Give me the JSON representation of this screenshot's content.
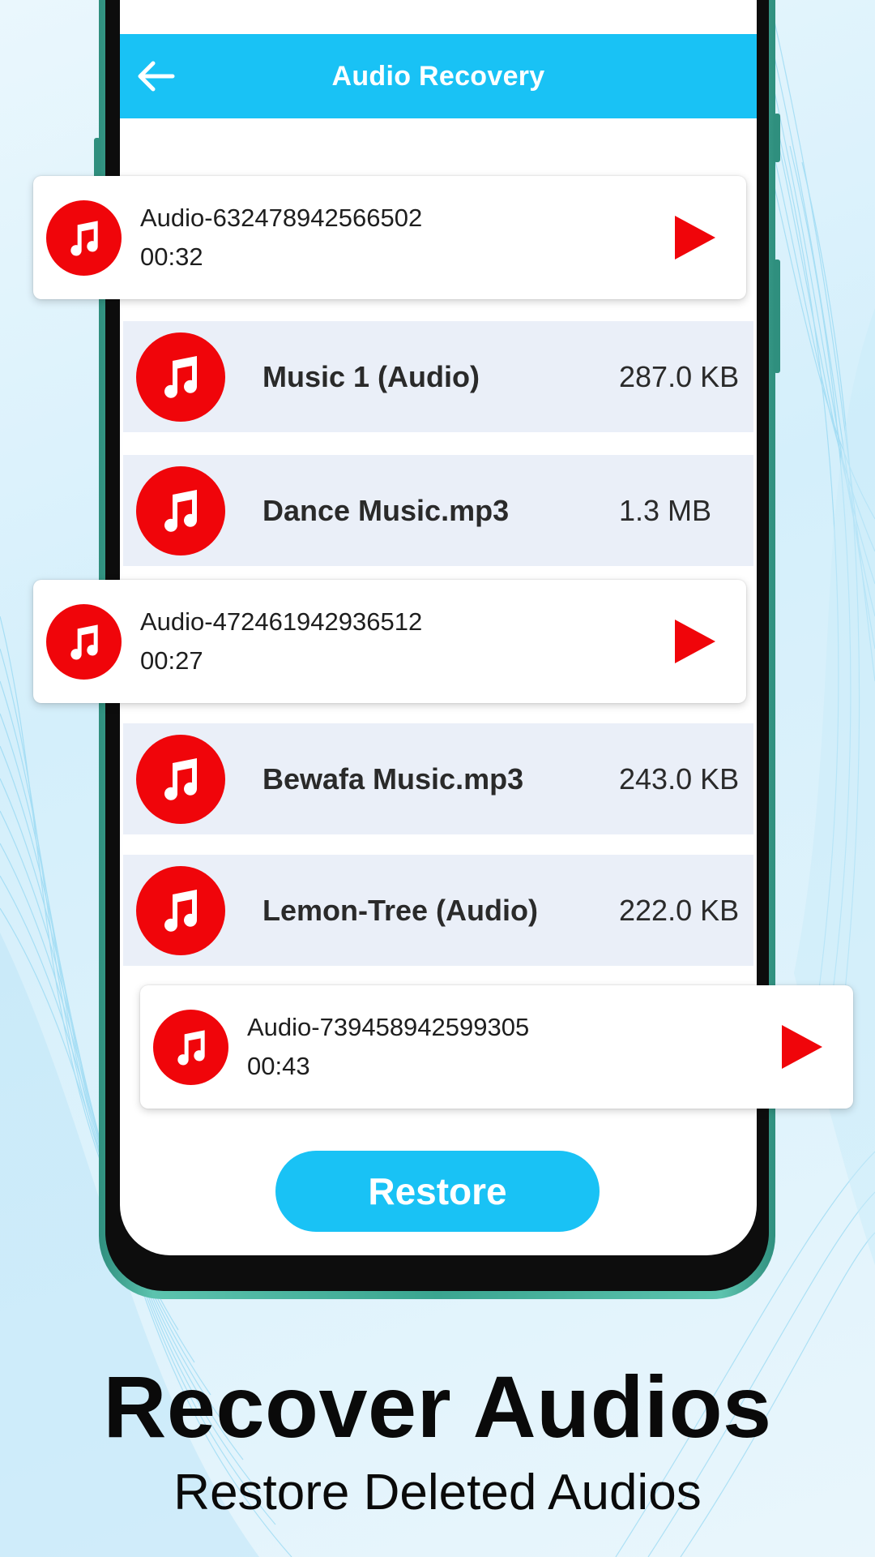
{
  "app": {
    "title": "Audio Recovery",
    "accent_color": "#19c2f5",
    "icon_color": "#f0050a"
  },
  "toolbar": {
    "back_icon": "arrow-left-icon"
  },
  "list": [
    {
      "name": "Music 1 (Audio)",
      "size": "287.0 KB",
      "icon": "music-note-icon"
    },
    {
      "name": "Dance Music.mp3",
      "size": "1.3 MB",
      "icon": "music-note-icon"
    },
    {
      "name": "Bewafa Music.mp3",
      "size": "243.0 KB",
      "icon": "music-note-icon"
    },
    {
      "name": "Lemon-Tree (Audio)",
      "size": "222.0 KB",
      "icon": "music-note-icon"
    }
  ],
  "cards": [
    {
      "title": "Audio-632478942566502",
      "duration": "00:32",
      "icon": "music-note-icon",
      "action_icon": "play-icon"
    },
    {
      "title": "Audio-472461942936512",
      "duration": "00:27",
      "icon": "music-note-icon",
      "action_icon": "play-icon"
    },
    {
      "title": "Audio-739458942599305",
      "duration": "00:43",
      "icon": "music-note-icon",
      "action_icon": "play-icon"
    }
  ],
  "restore_label": "Restore",
  "promo": {
    "headline": "Recover Audios",
    "subline": "Restore Deleted Audios"
  }
}
